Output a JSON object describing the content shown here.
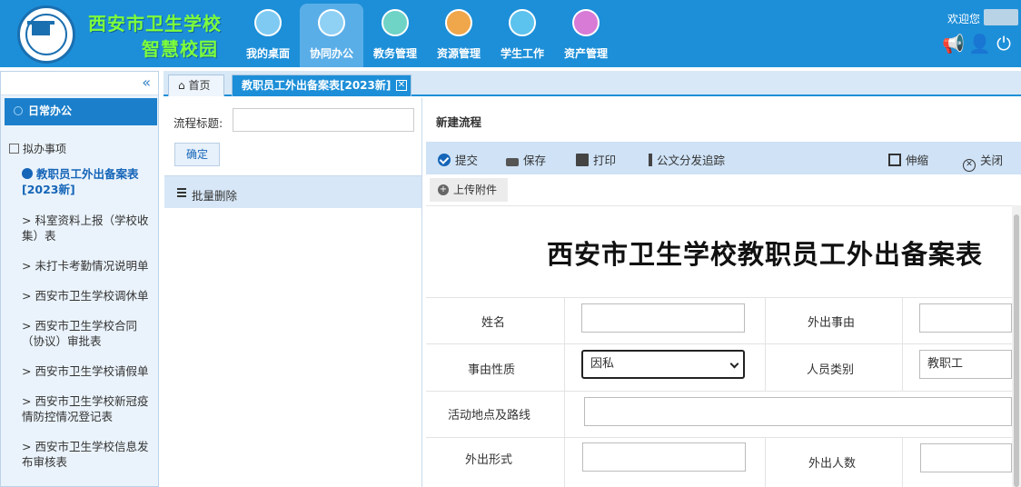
{
  "header": {
    "school_name": "西安市卫生学校",
    "system_name": "智慧校园",
    "welcome": "欢迎您",
    "nav": [
      {
        "label": "我的桌面",
        "icon": "desktop-icon",
        "active": false
      },
      {
        "label": "协同办公",
        "icon": "collaboration-icon",
        "active": true
      },
      {
        "label": "教务管理",
        "icon": "academic-icon",
        "active": false
      },
      {
        "label": "资源管理",
        "icon": "folder-icon",
        "active": false
      },
      {
        "label": "学生工作",
        "icon": "student-icon",
        "active": false
      },
      {
        "label": "资产管理",
        "icon": "asset-box-icon",
        "active": false
      }
    ]
  },
  "sidebar": {
    "collapse": "«",
    "section": "日常办公",
    "draft_header": "拟办事项",
    "items": [
      {
        "label": "教职员工外出备案表[2023新]",
        "active": true
      },
      {
        "label": "科室资料上报（学校收集）表",
        "active": false
      },
      {
        "label": "未打卡考勤情况说明单",
        "active": false
      },
      {
        "label": "西安市卫生学校调休单",
        "active": false
      },
      {
        "label": "西安市卫生学校合同（协议）审批表",
        "active": false
      },
      {
        "label": "西安市卫生学校请假单",
        "active": false
      },
      {
        "label": "西安市卫生学校新冠疫情防控情况登记表",
        "active": false
      },
      {
        "label": "西安市卫生学校信息发布审核表",
        "active": false
      }
    ]
  },
  "tabs": {
    "home": "首页",
    "current": "教职员工外出备案表[2023新]"
  },
  "middle": {
    "flow_title_label": "流程标题:",
    "flow_title_value": "",
    "ok": "确定",
    "batch_delete": "批量删除"
  },
  "right": {
    "title": "新建流程",
    "toolbar": {
      "submit": "提交",
      "save": "保存",
      "print": "打印",
      "track": "公文分发追踪",
      "expand": "伸缩",
      "close": "关闭"
    },
    "upload": "上传附件",
    "form": {
      "title": "西安市卫生学校教职员工外出备案表",
      "name_label": "姓名",
      "reason_label": "外出事由",
      "nature_label": "事由性质",
      "nature_value": "因私",
      "category_label": "人员类别",
      "category_value": "教职工",
      "route_label": "活动地点及路线",
      "form_label": "外出形式",
      "count_label": "外出人数"
    }
  },
  "colors": {
    "header_bg": "#1d8fd8",
    "accent": "#1565b8",
    "school_name": "#7dff3c"
  }
}
